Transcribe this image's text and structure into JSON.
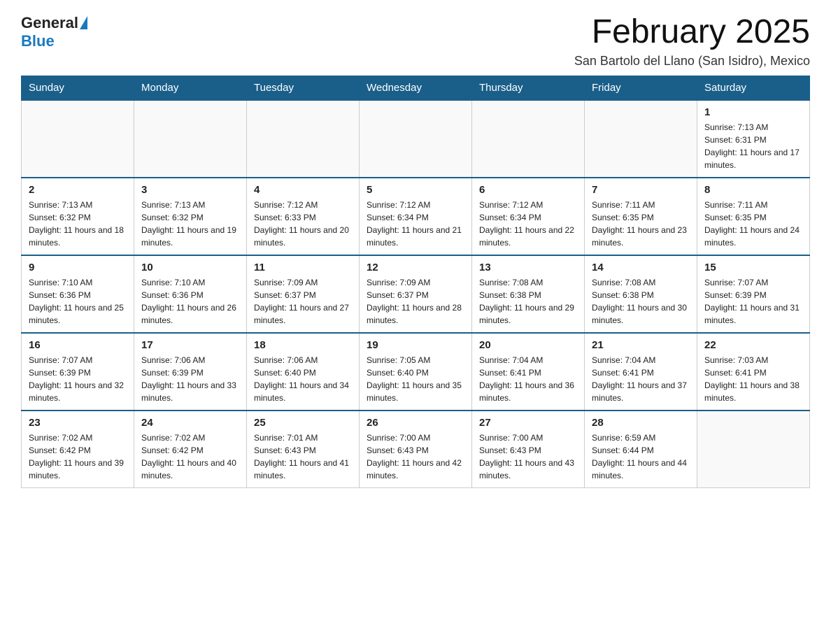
{
  "logo": {
    "general": "General",
    "blue": "Blue",
    "triangle": "▶"
  },
  "header": {
    "month_title": "February 2025",
    "location": "San Bartolo del Llano (San Isidro), Mexico"
  },
  "weekdays": [
    "Sunday",
    "Monday",
    "Tuesday",
    "Wednesday",
    "Thursday",
    "Friday",
    "Saturday"
  ],
  "weeks": [
    [
      {
        "day": "",
        "info": ""
      },
      {
        "day": "",
        "info": ""
      },
      {
        "day": "",
        "info": ""
      },
      {
        "day": "",
        "info": ""
      },
      {
        "day": "",
        "info": ""
      },
      {
        "day": "",
        "info": ""
      },
      {
        "day": "1",
        "info": "Sunrise: 7:13 AM\nSunset: 6:31 PM\nDaylight: 11 hours and 17 minutes."
      }
    ],
    [
      {
        "day": "2",
        "info": "Sunrise: 7:13 AM\nSunset: 6:32 PM\nDaylight: 11 hours and 18 minutes."
      },
      {
        "day": "3",
        "info": "Sunrise: 7:13 AM\nSunset: 6:32 PM\nDaylight: 11 hours and 19 minutes."
      },
      {
        "day": "4",
        "info": "Sunrise: 7:12 AM\nSunset: 6:33 PM\nDaylight: 11 hours and 20 minutes."
      },
      {
        "day": "5",
        "info": "Sunrise: 7:12 AM\nSunset: 6:34 PM\nDaylight: 11 hours and 21 minutes."
      },
      {
        "day": "6",
        "info": "Sunrise: 7:12 AM\nSunset: 6:34 PM\nDaylight: 11 hours and 22 minutes."
      },
      {
        "day": "7",
        "info": "Sunrise: 7:11 AM\nSunset: 6:35 PM\nDaylight: 11 hours and 23 minutes."
      },
      {
        "day": "8",
        "info": "Sunrise: 7:11 AM\nSunset: 6:35 PM\nDaylight: 11 hours and 24 minutes."
      }
    ],
    [
      {
        "day": "9",
        "info": "Sunrise: 7:10 AM\nSunset: 6:36 PM\nDaylight: 11 hours and 25 minutes."
      },
      {
        "day": "10",
        "info": "Sunrise: 7:10 AM\nSunset: 6:36 PM\nDaylight: 11 hours and 26 minutes."
      },
      {
        "day": "11",
        "info": "Sunrise: 7:09 AM\nSunset: 6:37 PM\nDaylight: 11 hours and 27 minutes."
      },
      {
        "day": "12",
        "info": "Sunrise: 7:09 AM\nSunset: 6:37 PM\nDaylight: 11 hours and 28 minutes."
      },
      {
        "day": "13",
        "info": "Sunrise: 7:08 AM\nSunset: 6:38 PM\nDaylight: 11 hours and 29 minutes."
      },
      {
        "day": "14",
        "info": "Sunrise: 7:08 AM\nSunset: 6:38 PM\nDaylight: 11 hours and 30 minutes."
      },
      {
        "day": "15",
        "info": "Sunrise: 7:07 AM\nSunset: 6:39 PM\nDaylight: 11 hours and 31 minutes."
      }
    ],
    [
      {
        "day": "16",
        "info": "Sunrise: 7:07 AM\nSunset: 6:39 PM\nDaylight: 11 hours and 32 minutes."
      },
      {
        "day": "17",
        "info": "Sunrise: 7:06 AM\nSunset: 6:39 PM\nDaylight: 11 hours and 33 minutes."
      },
      {
        "day": "18",
        "info": "Sunrise: 7:06 AM\nSunset: 6:40 PM\nDaylight: 11 hours and 34 minutes."
      },
      {
        "day": "19",
        "info": "Sunrise: 7:05 AM\nSunset: 6:40 PM\nDaylight: 11 hours and 35 minutes."
      },
      {
        "day": "20",
        "info": "Sunrise: 7:04 AM\nSunset: 6:41 PM\nDaylight: 11 hours and 36 minutes."
      },
      {
        "day": "21",
        "info": "Sunrise: 7:04 AM\nSunset: 6:41 PM\nDaylight: 11 hours and 37 minutes."
      },
      {
        "day": "22",
        "info": "Sunrise: 7:03 AM\nSunset: 6:41 PM\nDaylight: 11 hours and 38 minutes."
      }
    ],
    [
      {
        "day": "23",
        "info": "Sunrise: 7:02 AM\nSunset: 6:42 PM\nDaylight: 11 hours and 39 minutes."
      },
      {
        "day": "24",
        "info": "Sunrise: 7:02 AM\nSunset: 6:42 PM\nDaylight: 11 hours and 40 minutes."
      },
      {
        "day": "25",
        "info": "Sunrise: 7:01 AM\nSunset: 6:43 PM\nDaylight: 11 hours and 41 minutes."
      },
      {
        "day": "26",
        "info": "Sunrise: 7:00 AM\nSunset: 6:43 PM\nDaylight: 11 hours and 42 minutes."
      },
      {
        "day": "27",
        "info": "Sunrise: 7:00 AM\nSunset: 6:43 PM\nDaylight: 11 hours and 43 minutes."
      },
      {
        "day": "28",
        "info": "Sunrise: 6:59 AM\nSunset: 6:44 PM\nDaylight: 11 hours and 44 minutes."
      },
      {
        "day": "",
        "info": ""
      }
    ]
  ]
}
